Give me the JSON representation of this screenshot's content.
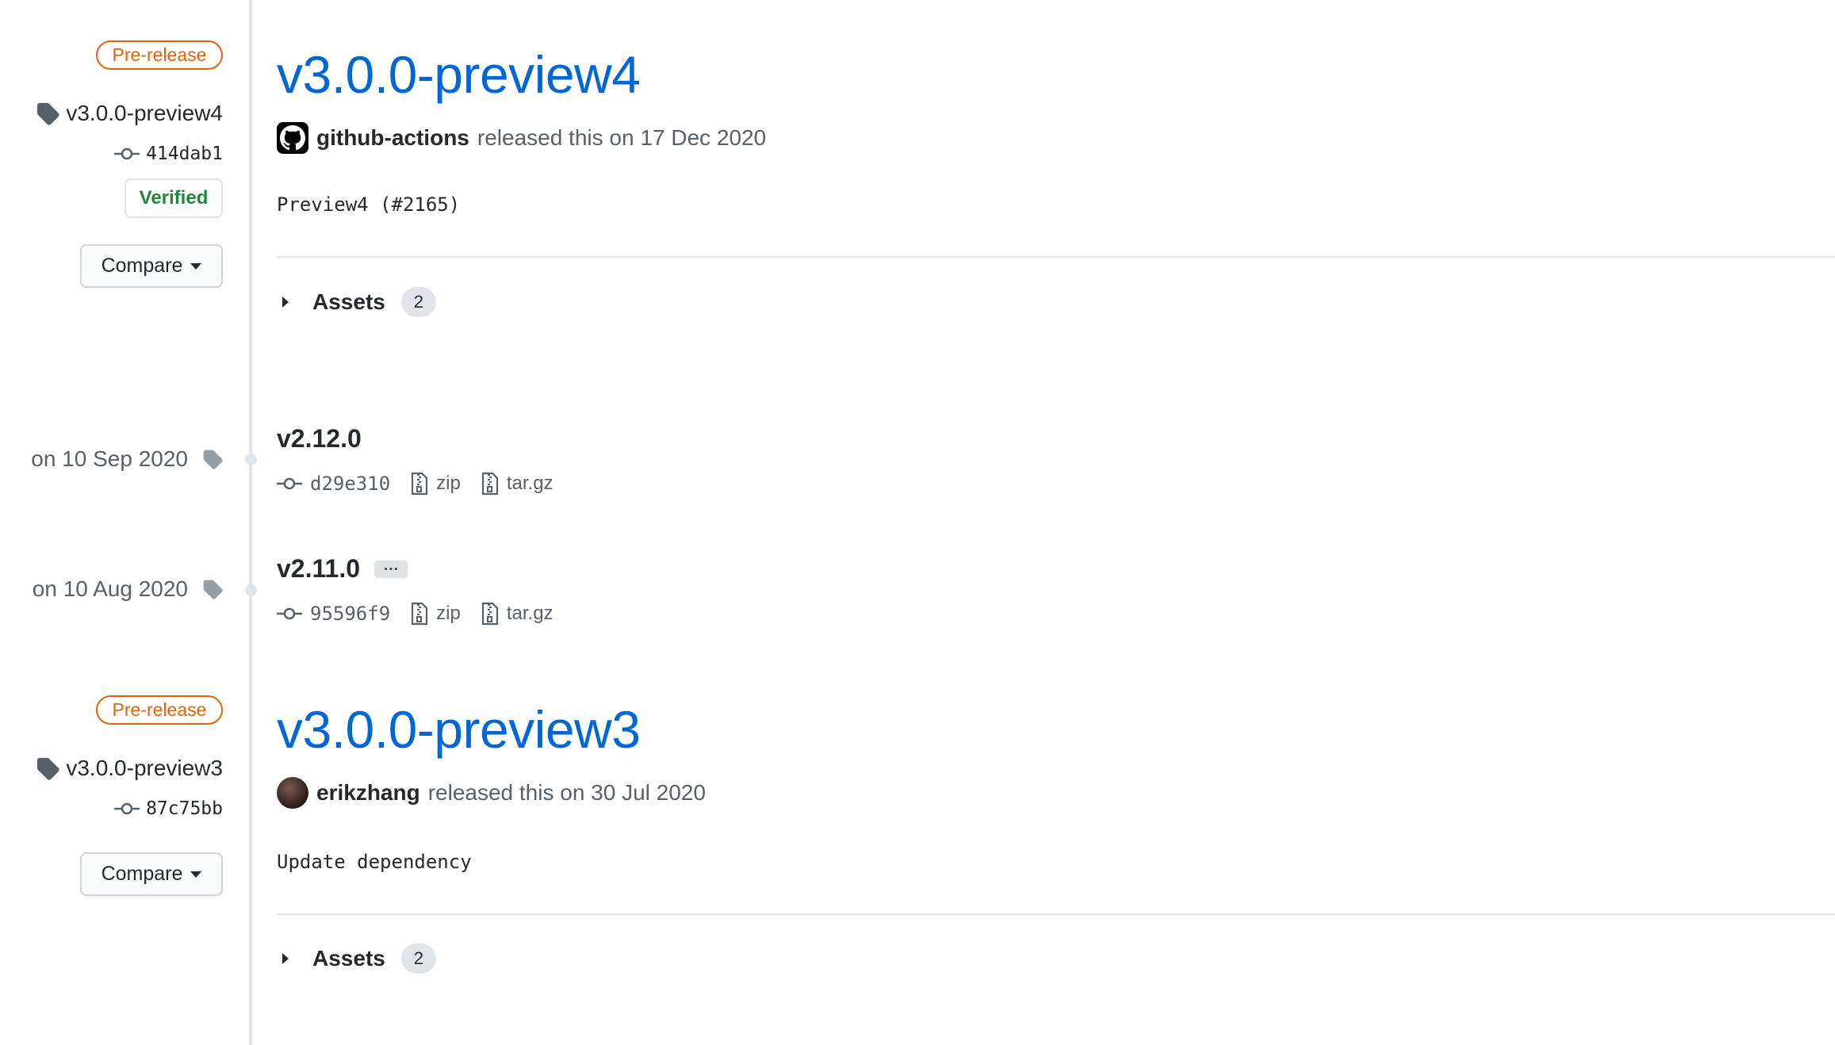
{
  "releases": [
    {
      "badge": "Pre-release",
      "tag": "v3.0.0-preview4",
      "commit": "414dab1",
      "verified": "Verified",
      "compare": "Compare",
      "title": "v3.0.0-preview4",
      "author": "github-actions",
      "released_text": "released this on 17 Dec 2020",
      "body": "Preview4 (#2165)",
      "assets_label": "Assets",
      "assets_count": "2"
    },
    {
      "badge": "Pre-release",
      "tag": "v3.0.0-preview3",
      "commit": "87c75bb",
      "compare": "Compare",
      "title": "v3.0.0-preview3",
      "author": "erikzhang",
      "released_text": "released this on 30 Jul 2020",
      "body": "Update dependency",
      "assets_label": "Assets",
      "assets_count": "2"
    }
  ],
  "tags": [
    {
      "date": "on 10 Sep 2020",
      "name": "v2.12.0",
      "commit": "d29e310",
      "zip": "zip",
      "targz": "tar.gz"
    },
    {
      "date": "on 10 Aug 2020",
      "name": "v2.11.0",
      "ellipsis": "…",
      "commit": "95596f9",
      "zip": "zip",
      "targz": "tar.gz"
    }
  ],
  "colors": {
    "link": "#0366d6",
    "prerelease": "#e36209",
    "verified": "#22863a"
  },
  "icons": [
    "tag-icon",
    "commit-icon",
    "file-zip-icon",
    "triangle-right-icon",
    "github-logo-icon"
  ]
}
